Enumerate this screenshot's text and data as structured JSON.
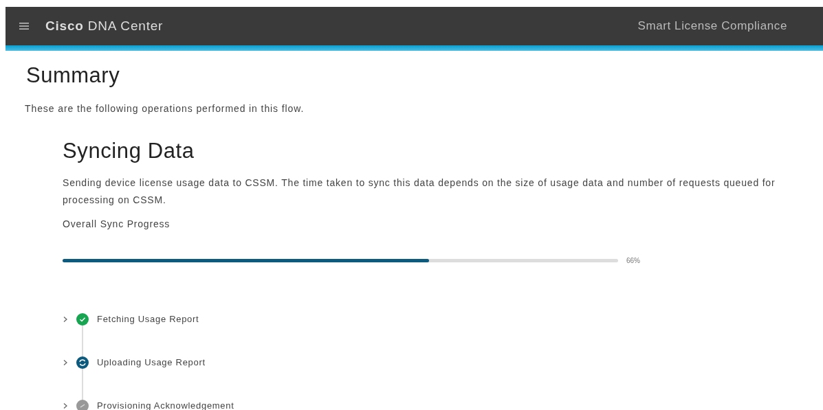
{
  "header": {
    "brand": "**Cisco** DNA Center",
    "page_title": "Smart License Compliance"
  },
  "summary": {
    "title": "Summary",
    "description": "These are the following operations performed in this flow."
  },
  "sync": {
    "title": "Syncing Data",
    "description": "Sending device license usage data to CSSM. The time taken to sync this data depends on the size of usage data and number of requests queued for processing on CSSM.",
    "progress_label": "Overall Sync Progress",
    "level": 0.66,
    "reading": "66%"
  },
  "steps": [
    {
      "label": "Fetching Usage Report",
      "kind": "done",
      "expanded": false
    },
    {
      "label": "Uploading Usage Report",
      "kind": "running",
      "expanded": false
    },
    {
      "label": "Provisioning Acknowledgement",
      "kind": "pending",
      "expanded": false
    }
  ]
}
